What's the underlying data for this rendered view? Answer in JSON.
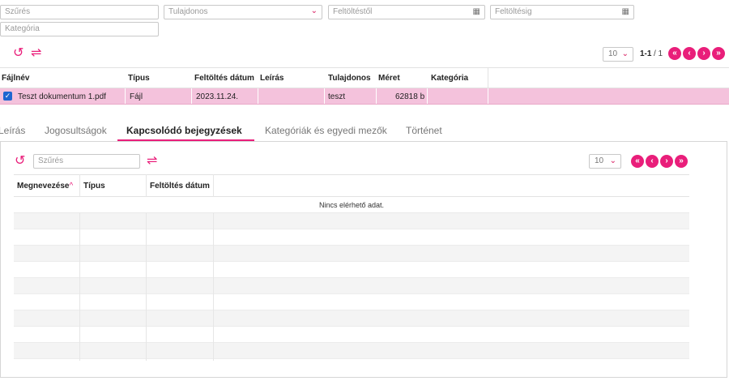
{
  "filters": {
    "search_placeholder": "Szűrés",
    "owner_placeholder": "Tulajdonos",
    "upload_from_placeholder": "Feltöltéstől",
    "upload_to_placeholder": "Feltöltésig",
    "category_placeholder": "Kategória"
  },
  "pager": {
    "page_size": "10",
    "range": "1-1",
    "total": "/ 1"
  },
  "grid": {
    "columns": [
      "Fájlnév",
      "Típus",
      "Feltöltés dátum",
      "Leírás",
      "Tulajdonos",
      "Méret",
      "Kategória"
    ],
    "rows": [
      {
        "checked": true,
        "filename": "Teszt dokumentum 1.pdf",
        "type": "Fájl",
        "upload_date": "2023.11.24.",
        "description": "",
        "owner": "teszt",
        "size": "62818 b",
        "category": ""
      }
    ]
  },
  "tabs": [
    {
      "label": "Leírás",
      "active": false
    },
    {
      "label": "Jogosultságok",
      "active": false
    },
    {
      "label": "Kapcsolódó bejegyzések",
      "active": true
    },
    {
      "label": "Kategóriák és egyedi mezők",
      "active": false
    },
    {
      "label": "Történet",
      "active": false
    }
  ],
  "related": {
    "search_placeholder": "Szűrés",
    "page_size": "10",
    "columns": [
      "Megnevezése",
      "Típus",
      "Feltöltés dátum"
    ],
    "sort_indicator": "^",
    "empty_text": "Nincs elérhető adat."
  },
  "colors": {
    "accent": "#e91e7a",
    "selected_row": "#f4c2dc",
    "checkbox": "#1e66d0"
  }
}
